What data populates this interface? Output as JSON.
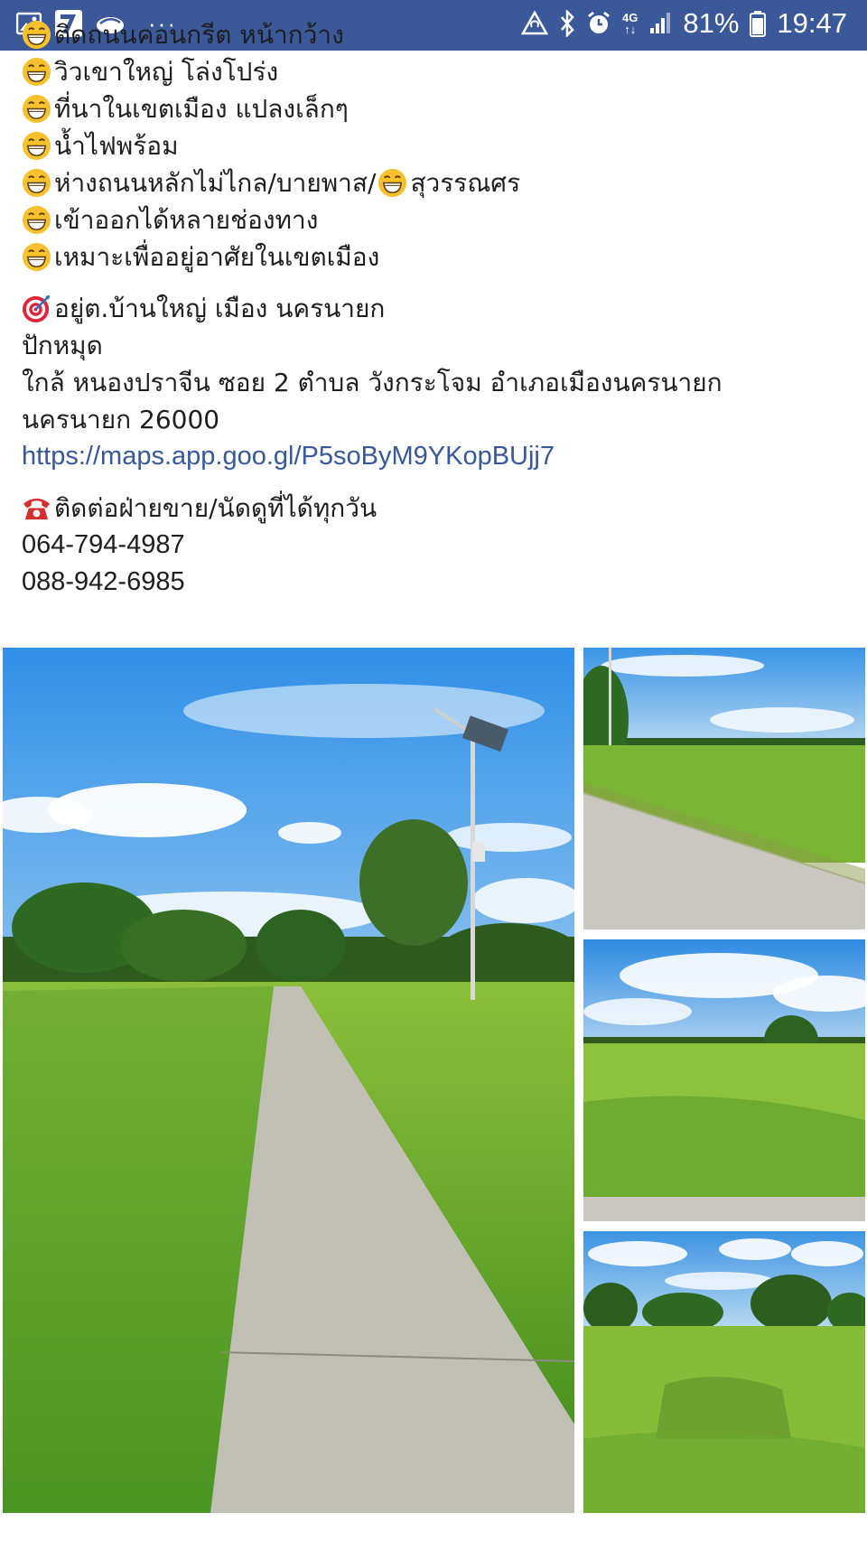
{
  "status_bar": {
    "left_icons": [
      "gallery-icon",
      "seven-eleven-app-icon",
      "cloud-app-icon",
      "more-dots-icon"
    ],
    "more_label": "···",
    "right_icons": [
      "data-saver-icon",
      "bluetooth-icon",
      "alarm-icon",
      "signal-icon",
      "battery-icon"
    ],
    "network_top": "4G",
    "network_bottom": "↑↓",
    "battery": "81%",
    "time": "19:47"
  },
  "post": {
    "feature_lines": [
      "ติดถนนคอนกรีต หน้ากว้าง",
      "วิวเขาใหญ่ โล่งโปร่ง",
      "ที่นาในเขตเมือง แปลงเล็กๆ",
      "น้ำไฟพร้อม",
      "ห่างถนนหลักไม่ไกล/บายพาส/",
      "เข้าออกได้หลายช่องทาง",
      "เหมาะเพื่ออยู่อาศัยในเขตเมือง"
    ],
    "feature_line5_suffix": "สุวรรณศร",
    "location_heading": "อยู่ต.บ้านใหญ่ เมือง นครนายก",
    "pin_label": "ปักหมุด",
    "address_line1": "ใกล้ หนองปราจีน ซอย 2 ตำบล วังกระโจม อำเภอเมืองนครนายก",
    "address_line2": "นครนายก 26000",
    "map_link": "https://maps.app.goo.gl/P5soByM9YKopBUjj7",
    "contact_heading": "ติดต่อฝ่ายขาย/นัดดูที่ได้ทุกวัน",
    "phones": [
      "064-794-4987",
      "088-942-6985"
    ]
  },
  "photos": [
    {
      "name": "main-road-photo",
      "subject": "concrete road with solar street light"
    },
    {
      "name": "field-road-photo",
      "subject": "road beside grass field"
    },
    {
      "name": "field-tree-photo",
      "subject": "open field with single tree"
    },
    {
      "name": "field-treeline-photo",
      "subject": "grass field with tree line"
    }
  ],
  "colors": {
    "status_bar": "#3b5998",
    "link": "#385898",
    "text": "#1c1e21",
    "emoji": "#f7c12e"
  }
}
